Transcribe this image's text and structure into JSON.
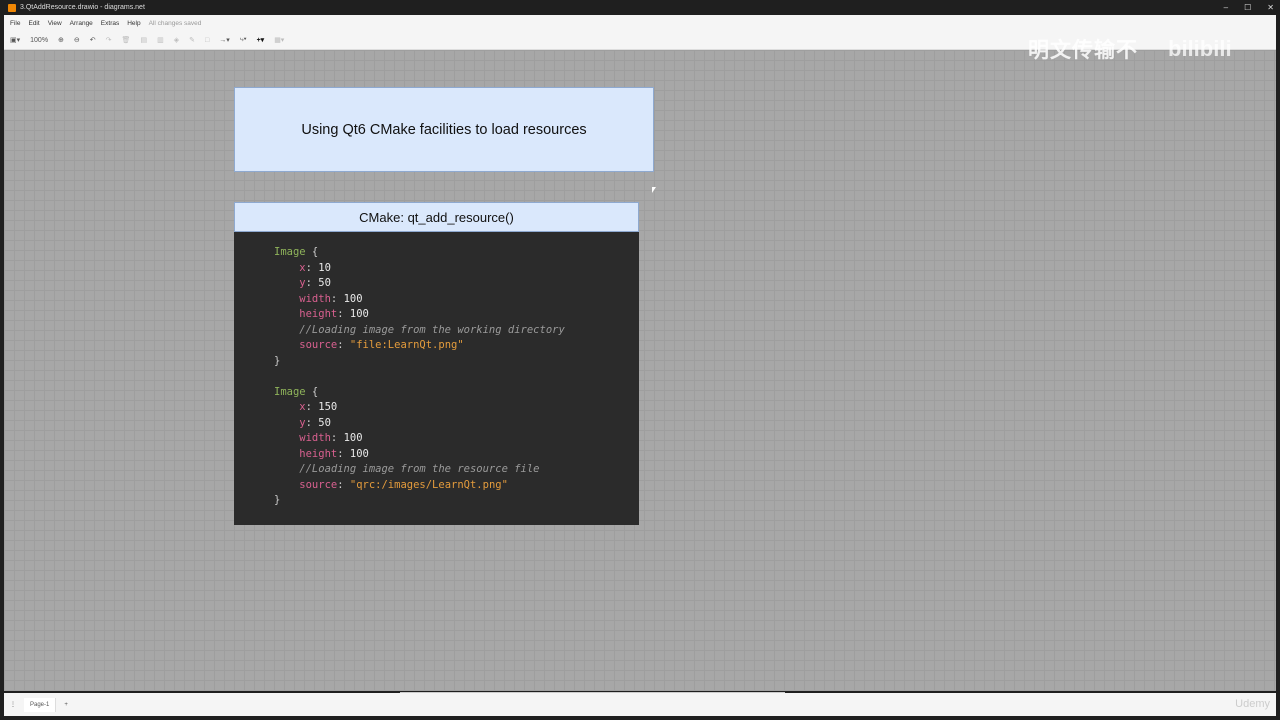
{
  "window": {
    "title": "3.QtAddResource.drawio - diagrams.net",
    "minimize": "–",
    "maximize": "☐",
    "close": "✕"
  },
  "menu": {
    "items": [
      "File",
      "Edit",
      "View",
      "Arrange",
      "Extras",
      "Help"
    ],
    "status": "All changes saved"
  },
  "toolbar": {
    "zoom": "100%"
  },
  "diagram": {
    "title": "Using Qt6 CMake facilities to load resources",
    "header": "CMake: qt_add_resource()",
    "code": [
      [
        {
          "t": "Image",
          "c": "type"
        },
        {
          "t": " {",
          "c": "punct"
        }
      ],
      [
        {
          "t": "    x",
          "c": "prop"
        },
        {
          "t": ": ",
          "c": "punct"
        },
        {
          "t": "10",
          "c": "num"
        }
      ],
      [
        {
          "t": "    y",
          "c": "prop"
        },
        {
          "t": ": ",
          "c": "punct"
        },
        {
          "t": "50",
          "c": "num"
        }
      ],
      [
        {
          "t": "    width",
          "c": "prop"
        },
        {
          "t": ": ",
          "c": "punct"
        },
        {
          "t": "100",
          "c": "num"
        }
      ],
      [
        {
          "t": "    height",
          "c": "prop"
        },
        {
          "t": ": ",
          "c": "punct"
        },
        {
          "t": "100",
          "c": "num"
        }
      ],
      [
        {
          "t": "    //Loading image from the working directory",
          "c": "com"
        }
      ],
      [
        {
          "t": "    source",
          "c": "prop"
        },
        {
          "t": ": ",
          "c": "punct"
        },
        {
          "t": "\"file:LearnQt.png\"",
          "c": "str"
        }
      ],
      [
        {
          "t": "}",
          "c": "punct"
        }
      ],
      [
        {
          "t": " ",
          "c": "punct"
        }
      ],
      [
        {
          "t": "Image",
          "c": "type"
        },
        {
          "t": " {",
          "c": "punct"
        }
      ],
      [
        {
          "t": "    x",
          "c": "prop"
        },
        {
          "t": ": ",
          "c": "punct"
        },
        {
          "t": "150",
          "c": "num"
        }
      ],
      [
        {
          "t": "    y",
          "c": "prop"
        },
        {
          "t": ": ",
          "c": "punct"
        },
        {
          "t": "50",
          "c": "num"
        }
      ],
      [
        {
          "t": "    width",
          "c": "prop"
        },
        {
          "t": ": ",
          "c": "punct"
        },
        {
          "t": "100",
          "c": "num"
        }
      ],
      [
        {
          "t": "    height",
          "c": "prop"
        },
        {
          "t": ": ",
          "c": "punct"
        },
        {
          "t": "100",
          "c": "num"
        }
      ],
      [
        {
          "t": "    //Loading image from the resource file",
          "c": "com"
        }
      ],
      [
        {
          "t": "    source",
          "c": "prop"
        },
        {
          "t": ": ",
          "c": "punct"
        },
        {
          "t": "\"qrc:/images/LearnQt.png\"",
          "c": "str"
        }
      ],
      [
        {
          "t": "}",
          "c": "punct"
        }
      ]
    ]
  },
  "overlay": {
    "watermark": "明文传输不",
    "bilibili": "bilibili",
    "udemy": "Udemy"
  },
  "pages": {
    "current": "Page-1",
    "add": "+"
  }
}
